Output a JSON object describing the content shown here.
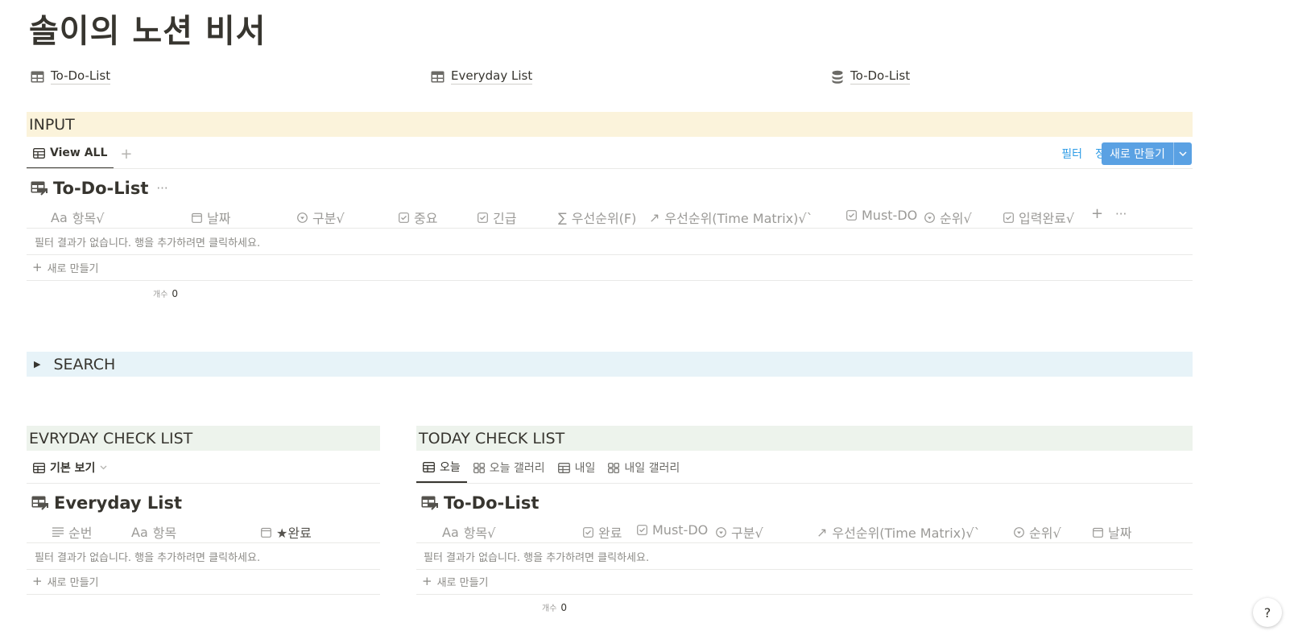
{
  "page": {
    "title": "솔이의 노션 비서"
  },
  "links": [
    {
      "label": "To-Do-List",
      "icon": "table-icon"
    },
    {
      "label": "Everyday List",
      "icon": "table-icon"
    },
    {
      "label": "To-Do-List",
      "icon": "database-icon"
    }
  ],
  "input_section": {
    "heading": "INPUT",
    "color": "#fbf3db",
    "tabs": [
      {
        "label": "View ALL"
      }
    ],
    "toolbar": {
      "filter": "필터",
      "sort": "정렬",
      "new_label": "새로 만들기"
    },
    "db_title": "To-Do-List",
    "columns": [
      "항목√",
      "날짜",
      "구분√",
      "중요",
      "긴급",
      "우선순위(F)",
      "우선순위(Time Matrix)√`",
      "Must-DO",
      "순위√",
      "입력완료√"
    ],
    "empty_text": "필터 결과가 없습니다. 행을 추가하려면 클릭하세요.",
    "new_row": "새로 만들기",
    "count_label": "개수",
    "count_value": "0"
  },
  "search_section": {
    "heading": "SEARCH",
    "color": "#e7f3f8"
  },
  "everyday_section": {
    "heading": "EVRYDAY CHECK LIST",
    "color": "#edf3ec",
    "view_label": "기본 보기",
    "db_title": "Everyday List",
    "columns": [
      "순번",
      "항목",
      "★완료"
    ],
    "empty_text": "필터 결과가 없습니다. 행을 추가하려면 클릭하세요.",
    "new_row": "새로 만들기"
  },
  "today_section": {
    "heading": "TODAY CHECK LIST",
    "color": "#edf3ec",
    "tabs": [
      {
        "label": "오늘"
      },
      {
        "label": "오늘 갤러리"
      },
      {
        "label": "내일"
      },
      {
        "label": "내일 갤러리"
      }
    ],
    "db_title": "To-Do-List",
    "columns": [
      "항목√",
      "완료",
      "Must-DO",
      "구분√",
      "우선순위(Time Matrix)√`",
      "순위√",
      "날짜"
    ],
    "empty_text": "필터 결과가 없습니다. 행을 추가하려면 클릭하세요.",
    "new_row": "새로 만들기",
    "count_label": "개수",
    "count_value": "0"
  },
  "help_label": "?"
}
